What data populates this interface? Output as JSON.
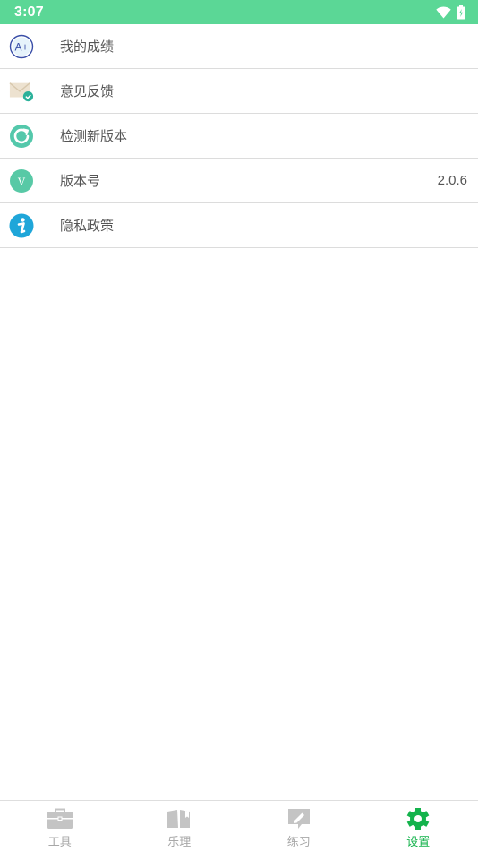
{
  "status_bar": {
    "time": "3:07",
    "wifi_icon": "wifi-icon",
    "battery_icon": "battery-charging-icon"
  },
  "settings": {
    "items": [
      {
        "icon": "grade-a-plus-icon",
        "label": "我的成绩",
        "value": ""
      },
      {
        "icon": "mail-check-icon",
        "label": "意见反馈",
        "value": ""
      },
      {
        "icon": "refresh-icon",
        "label": "检测新版本",
        "value": ""
      },
      {
        "icon": "version-v-icon",
        "label": "版本号",
        "value": "2.0.6"
      },
      {
        "icon": "info-icon",
        "label": "隐私政策",
        "value": ""
      }
    ]
  },
  "bottom_nav": {
    "active_color": "#14b34c",
    "inactive_color": "#a8a8a8",
    "items": [
      {
        "icon": "toolbox-icon",
        "label": "工具",
        "active": false
      },
      {
        "icon": "book-icon",
        "label": "乐理",
        "active": false
      },
      {
        "icon": "pencil-icon",
        "label": "练习",
        "active": false
      },
      {
        "icon": "gear-icon",
        "label": "设置",
        "active": true
      }
    ]
  },
  "colors": {
    "status_bar": "#5bd796",
    "divider": "#dcdcdc"
  }
}
